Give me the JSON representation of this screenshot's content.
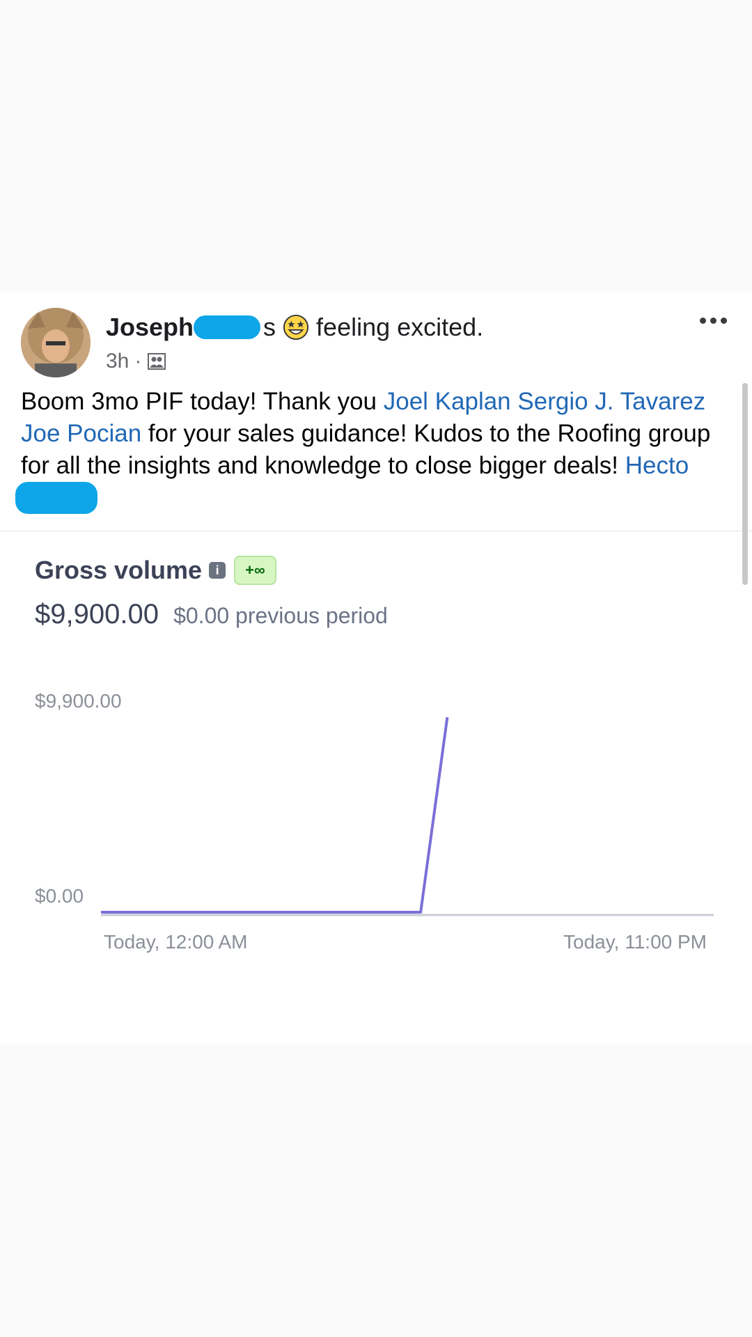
{
  "post": {
    "author_name": "Joseph",
    "author_suffix": "s",
    "feeling": "feeling excited.",
    "timestamp": "3h",
    "separator": "·",
    "audience_icon": "friends-icon",
    "more_icon": "more-options-icon",
    "body": {
      "intro": "Boom 3mo PIF today! Thank you ",
      "mention1": "Joel Kaplan",
      "space1": " ",
      "mention2": "Sergio J. Tavarez",
      "space2": " ",
      "mention3": "Joe Pocian",
      "middle": " for your sales guidance! Kudos to the Roofing group for all the insights and knowledge to close bigger deals! ",
      "mention4": "Hecto"
    }
  },
  "card": {
    "title": "Gross volume",
    "badge": "+∞",
    "total": "$9,900.00",
    "previous": "$0.00 previous period"
  },
  "chart_data": {
    "type": "line",
    "y_tick_labels": [
      "$9,900.00",
      "$0.00"
    ],
    "x_tick_labels": [
      "Today, 12:00 AM",
      "Today, 11:00 PM"
    ],
    "ylim": [
      0,
      9900
    ],
    "series": [
      {
        "color": "#7b6fd8",
        "points": [
          {
            "x_hour": 0,
            "y": 0
          },
          {
            "x_hour": 12,
            "y": 0
          },
          {
            "x_hour": 13,
            "y": 9900
          }
        ]
      }
    ],
    "x_range_hours": [
      0,
      23
    ],
    "baseline_color": "#c9ccd6"
  }
}
